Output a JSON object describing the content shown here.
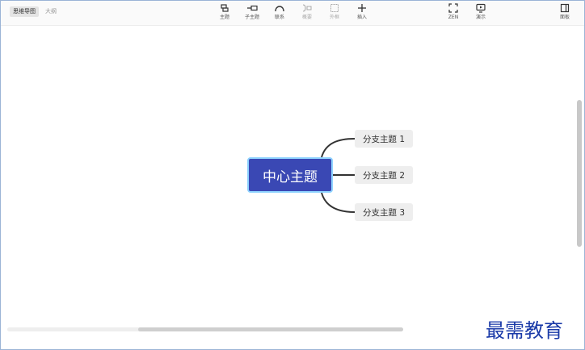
{
  "view_tabs": {
    "mindmap": "思维导图",
    "outline": "大纲"
  },
  "toolbar": {
    "topic": "主题",
    "subtopic": "子主题",
    "relationship": "联系",
    "summary": "概要",
    "boundary": "外框",
    "insert": "插入",
    "zen": "ZEN",
    "present": "演示",
    "panel": "面板"
  },
  "mindmap": {
    "central_topic": "中心主题",
    "branches": [
      {
        "label": "分支主题 1"
      },
      {
        "label": "分支主题 2"
      },
      {
        "label": "分支主题 3"
      }
    ]
  },
  "watermark": "最需教育",
  "colors": {
    "central_fill": "#3a48b4",
    "central_border": "#8fd3ff",
    "branch_fill": "#eeeeee",
    "connector": "#333333",
    "watermark": "#1a3aa8"
  },
  "icons": [
    "topic-icon",
    "subtopic-icon",
    "relationship-icon",
    "summary-icon",
    "boundary-icon",
    "insert-icon",
    "zen-icon",
    "present-icon",
    "panel-icon"
  ]
}
